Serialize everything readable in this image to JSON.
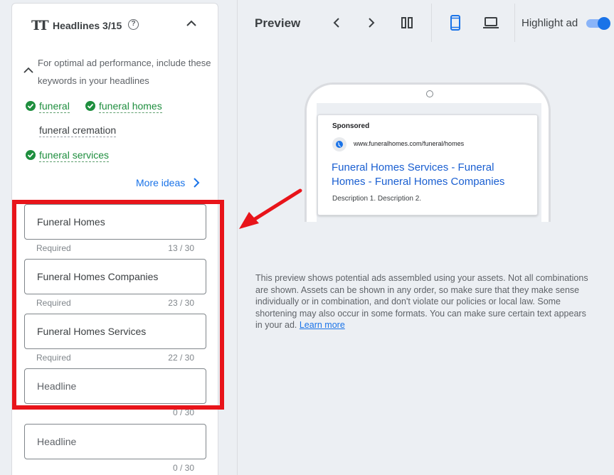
{
  "headlines_panel": {
    "icon": "text-size-icon",
    "tt_glyph": "TT",
    "title": "Headlines 3/15",
    "help_glyph": "?",
    "tip": "For optimal ad performance, include these keywords in your headlines",
    "keywords": [
      {
        "text": "funeral",
        "used": true
      },
      {
        "text": "funeral homes",
        "used": true
      },
      {
        "text": "funeral cremation",
        "used": false
      },
      {
        "text": "funeral services",
        "used": true
      }
    ],
    "more_ideas": "More ideas",
    "fields": [
      {
        "value": "Funeral Homes",
        "placeholder": "",
        "required": "Required",
        "count": "13 / 30"
      },
      {
        "value": "Funeral Homes Companies",
        "placeholder": "",
        "required": "Required",
        "count": "23 / 30"
      },
      {
        "value": "Funeral Homes Services",
        "placeholder": "",
        "required": "Required",
        "count": "22 / 30"
      },
      {
        "value": "",
        "placeholder": "Headline",
        "required": "",
        "count": "0 / 30"
      },
      {
        "value": "",
        "placeholder": "Headline",
        "required": "",
        "count": "0 / 30"
      }
    ]
  },
  "preview": {
    "title": "Preview",
    "highlight_label": "Highlight ad",
    "highlight_on": true,
    "ad": {
      "sponsored": "Sponsored",
      "url": "www.funeralhomes.com/funeral/homes",
      "headline": "Funeral Homes Services - Funeral Homes - Funeral Homes Companies",
      "description": "Description 1. Description 2."
    },
    "note": "This preview shows potential ads assembled using your assets. Not all combinations are shown. Assets can be shown in any order, so make sure that they make sense individually or in combination, and don't violate our policies or local law. Some shortening may also occur in some formats. You can make sure certain text appears in your ad.",
    "learn_more": "Learn more"
  },
  "colors": {
    "accent": "#1a73e8",
    "keyword_ok": "#1e8e3e",
    "annotation_red": "#e8141a"
  }
}
